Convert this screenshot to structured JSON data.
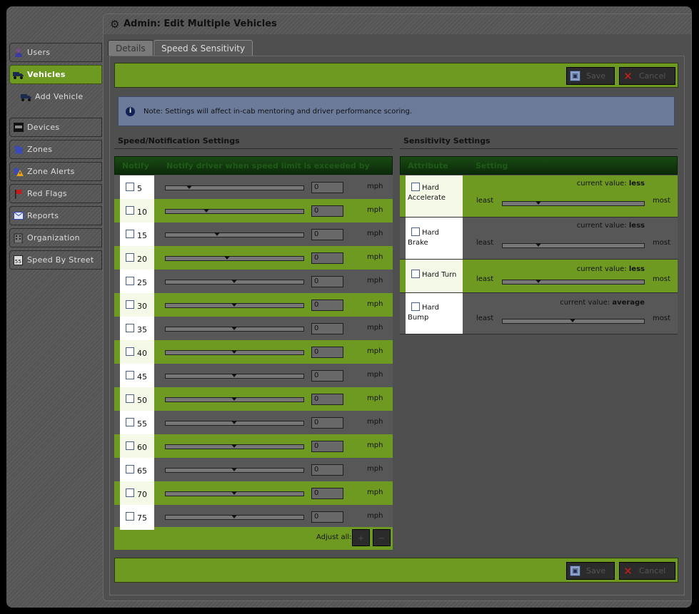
{
  "page": {
    "title": "Admin: Edit Multiple Vehicles"
  },
  "sidebar": {
    "items": [
      {
        "label": "Users",
        "icon": "user-icon"
      },
      {
        "label": "Vehicles",
        "icon": "truck-icon",
        "active": true
      },
      {
        "label": "Add Vehicle",
        "icon": "add-truck-icon"
      },
      {
        "label": "Devices",
        "icon": "device-icon"
      },
      {
        "label": "Zones",
        "icon": "zone-icon"
      },
      {
        "label": "Zone Alerts",
        "icon": "alert-icon"
      },
      {
        "label": "Red Flags",
        "icon": "flag-icon"
      },
      {
        "label": "Reports",
        "icon": "mail-icon"
      },
      {
        "label": "Organization",
        "icon": "building-icon"
      },
      {
        "label": "Speed By Street",
        "icon": "speed-sign-icon"
      }
    ]
  },
  "tabs": [
    {
      "label": "Details"
    },
    {
      "label": "Speed & Sensitivity",
      "active": true
    }
  ],
  "toolbar": {
    "save_label": "Save",
    "cancel_label": "Cancel"
  },
  "note": "Note: Settings will affect in-cab mentoring and driver performance scoring.",
  "speed_section": {
    "title": "Speed/Notification Settings",
    "columns": [
      "Notify",
      "Notify driver when speed limit is exceeded by",
      ""
    ],
    "rows": [
      {
        "speed": "5",
        "value": "0",
        "unit": "mph",
        "thumb": 0.17
      },
      {
        "speed": "10",
        "value": "0",
        "unit": "mph",
        "thumb": 0.29
      },
      {
        "speed": "15",
        "value": "0",
        "unit": "mph",
        "thumb": 0.37
      },
      {
        "speed": "20",
        "value": "0",
        "unit": "mph",
        "thumb": 0.44
      },
      {
        "speed": "25",
        "value": "0",
        "unit": "mph",
        "thumb": 0.49
      },
      {
        "speed": "30",
        "value": "0",
        "unit": "mph",
        "thumb": 0.49
      },
      {
        "speed": "35",
        "value": "0",
        "unit": "mph",
        "thumb": 0.49
      },
      {
        "speed": "40",
        "value": "0",
        "unit": "mph",
        "thumb": 0.49
      },
      {
        "speed": "45",
        "value": "0",
        "unit": "mph",
        "thumb": 0.49
      },
      {
        "speed": "50",
        "value": "0",
        "unit": "mph",
        "thumb": 0.49
      },
      {
        "speed": "55",
        "value": "0",
        "unit": "mph",
        "thumb": 0.49
      },
      {
        "speed": "60",
        "value": "0",
        "unit": "mph",
        "thumb": 0.49
      },
      {
        "speed": "65",
        "value": "0",
        "unit": "mph",
        "thumb": 0.49
      },
      {
        "speed": "70",
        "value": "0",
        "unit": "mph",
        "thumb": 0.49
      },
      {
        "speed": "75",
        "value": "0",
        "unit": "mph",
        "thumb": 0.49
      }
    ],
    "adjust_all_label": "Adjust all:",
    "plus_label": "+",
    "minus_label": "−"
  },
  "sensitivity_section": {
    "title": "Sensitivity Settings",
    "columns": [
      "Attribute",
      "Setting"
    ],
    "least_label": "least",
    "most_label": "most",
    "rows": [
      {
        "label_line1": "Hard",
        "label_line2": "Accelerate",
        "current_label": "current value:",
        "current_value": "less",
        "thumb": 0.25
      },
      {
        "label_line1": "Hard",
        "label_line2": "Brake",
        "current_label": "current value:",
        "current_value": "less",
        "thumb": 0.25
      },
      {
        "label_line1": "Hard Turn",
        "label_line2": "",
        "current_label": "current value:",
        "current_value": "less",
        "thumb": 0.25
      },
      {
        "label_line1": "Hard",
        "label_line2": "Bump",
        "current_label": "current value:",
        "current_value": "average",
        "thumb": 0.49
      }
    ]
  },
  "colors": {
    "accent_green": "#6f9a22",
    "table_header": "#0b2a09",
    "note_bg": "#6d7b9b"
  }
}
